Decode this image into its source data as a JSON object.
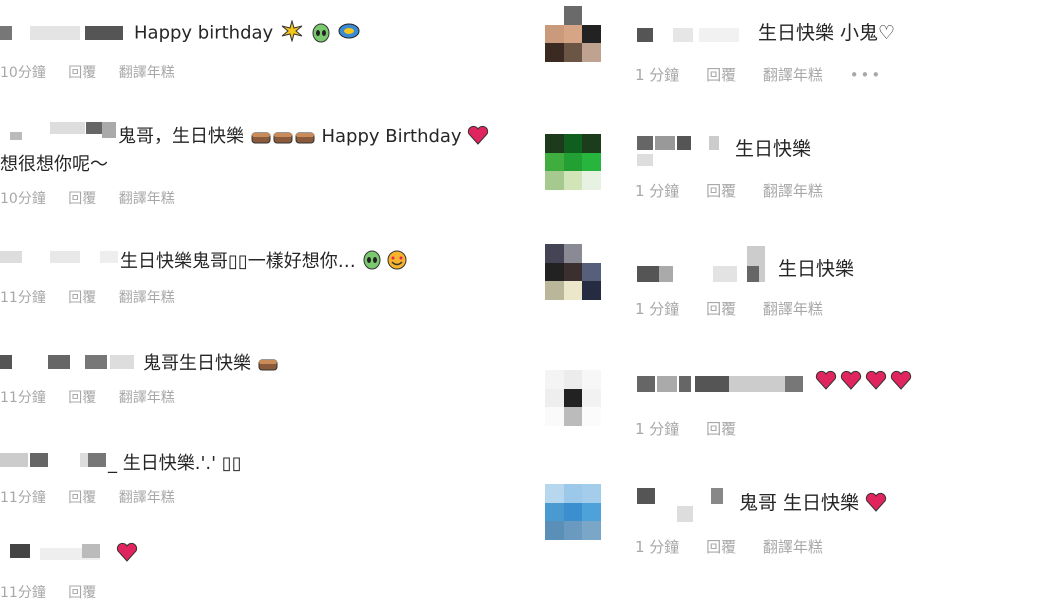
{
  "left_comments": [
    {
      "text": "Happy birthday",
      "meta": [
        "10分鐘",
        "回覆",
        "翻譯年糕"
      ]
    },
    {
      "text": "鬼哥，生日快樂",
      "text2": "Happy Birthday",
      "line2": "想很想你呢～",
      "meta": [
        "10分鐘",
        "回覆",
        "翻譯年糕"
      ]
    },
    {
      "text": "生日快樂鬼哥▯▯一樣好想你…",
      "meta": [
        "11分鐘",
        "回覆",
        "翻譯年糕"
      ]
    },
    {
      "text": "鬼哥生日快樂",
      "meta": [
        "11分鐘",
        "回覆",
        "翻譯年糕"
      ]
    },
    {
      "text": "_ 生日快樂.'.' ▯▯",
      "meta": [
        "11分鐘",
        "回覆",
        "翻譯年糕"
      ]
    },
    {
      "text": "",
      "meta": [
        "11分鐘",
        "回覆"
      ]
    }
  ],
  "right_comments": [
    {
      "text": "生日快樂 小鬼♡",
      "meta": [
        "1 分鐘",
        "回覆",
        "翻譯年糕"
      ],
      "more": "•••"
    },
    {
      "text": "生日快樂",
      "meta": [
        "1 分鐘",
        "回覆",
        "翻譯年糕"
      ]
    },
    {
      "text": "生日快樂",
      "meta": [
        "1 分鐘",
        "回覆",
        "翻譯年糕"
      ]
    },
    {
      "text": "",
      "meta": [
        "1 分鐘",
        "回覆"
      ]
    },
    {
      "text": "鬼哥 生日快樂",
      "meta": [
        "1 分鐘",
        "回覆",
        "翻譯年糕"
      ]
    }
  ],
  "colors": {
    "text": "#262626",
    "meta": "#a8a8a8",
    "heart": "#e0245e",
    "blur": "#cfcfcf"
  }
}
